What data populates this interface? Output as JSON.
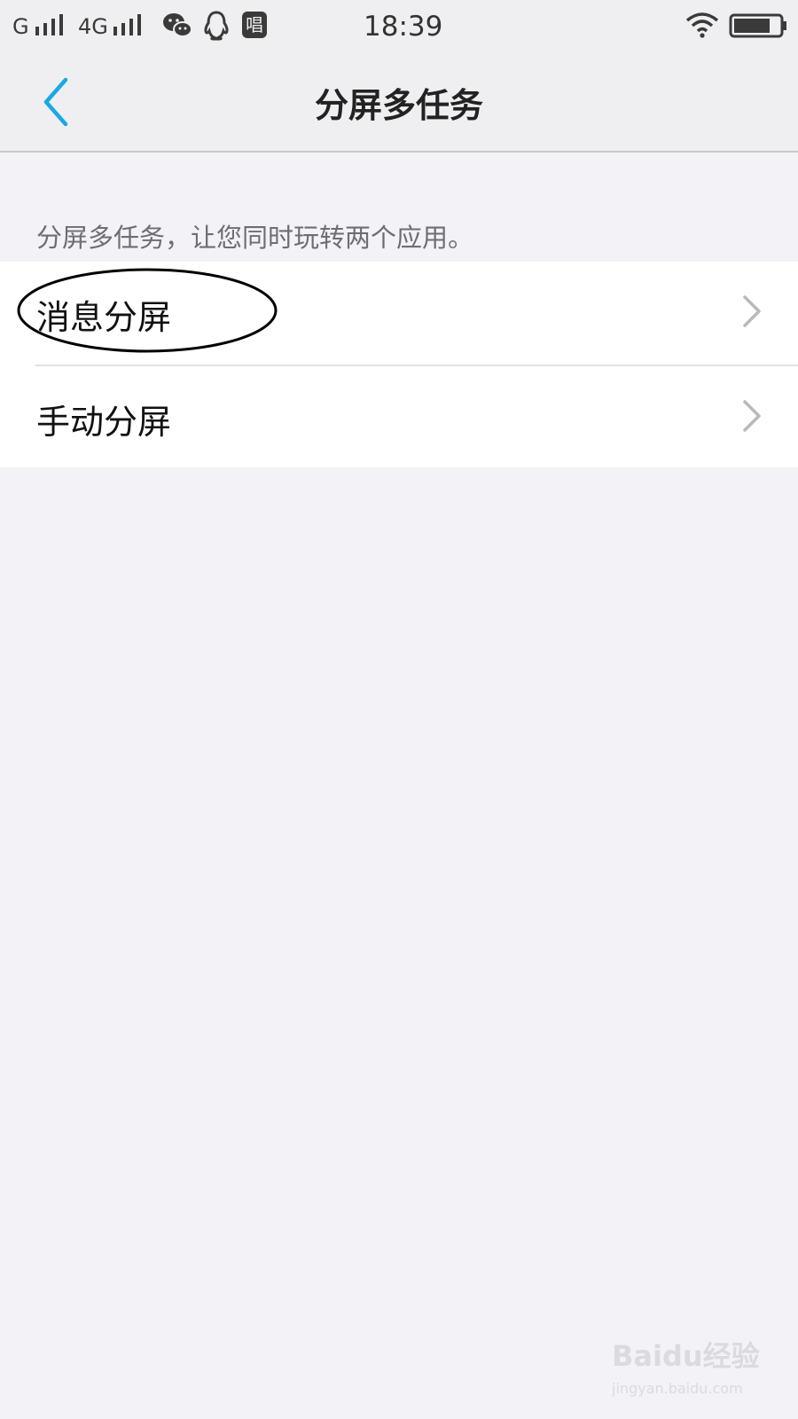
{
  "status_bar": {
    "carrier1": "G",
    "carrier2": "4G",
    "time": "18:39",
    "icons": [
      "signal-icon",
      "wechat-icon",
      "qq-icon",
      "sing-app-icon",
      "wifi-icon",
      "battery-icon"
    ],
    "app_badge": "唱",
    "battery_level": 0.8
  },
  "nav": {
    "title": "分屏多任务",
    "back_icon": "chevron-left-icon",
    "accent_color": "#1aa7e6"
  },
  "description": "分屏多任务，让您同时玩转两个应用。",
  "items": [
    {
      "label": "消息分屏",
      "icon": "chevron-right-icon"
    },
    {
      "label": "手动分屏",
      "icon": "chevron-right-icon"
    }
  ],
  "annotation": {
    "shape": "ellipse",
    "target": "消息分屏",
    "color": "#000000"
  },
  "watermark": {
    "logo": "Baidu经验",
    "url": "jingyan.baidu.com"
  }
}
